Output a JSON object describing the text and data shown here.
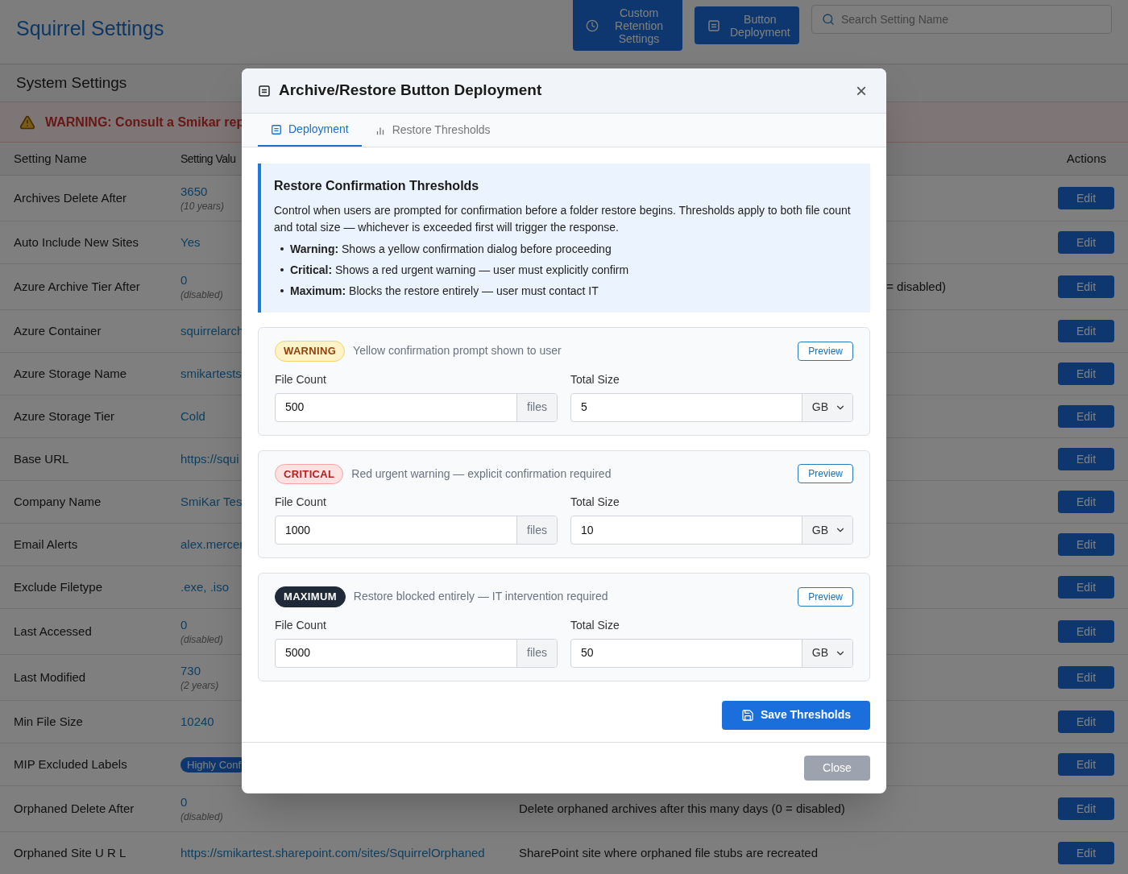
{
  "app_title": "Squirrel Settings",
  "header_buttons": [
    {
      "label": "Custom Retention Settings"
    },
    {
      "label": "Button Deployment"
    }
  ],
  "search": {
    "placeholder": "Search Setting Name"
  },
  "section_title": "System Settings",
  "warning": "WARNING: Consult a Smikar rep",
  "table": {
    "columns": [
      "Setting Name",
      "Setting Valu",
      "Actions"
    ],
    "rows": [
      {
        "name": "Archives Delete After",
        "value": "3650",
        "note": "(10 years)",
        "action": "Edit"
      },
      {
        "name": "Auto Include New Sites",
        "value": "Yes",
        "action": "Edit"
      },
      {
        "name": "Azure Archive Tier After",
        "value": "0",
        "note": "(disabled)",
        "description": "= disabled)",
        "description_cut": true,
        "action": "Edit"
      },
      {
        "name": "Azure Container",
        "value": "squirrelarch",
        "action": "Edit"
      },
      {
        "name": "Azure Storage Name",
        "value": "smikartests",
        "action": "Edit"
      },
      {
        "name": "Azure Storage Tier",
        "value": "Cold",
        "action": "Edit"
      },
      {
        "name": "Base URL",
        "value": "https://squi",
        "action": "Edit"
      },
      {
        "name": "Company Name",
        "value": "SmiKar Tes",
        "action": "Edit"
      },
      {
        "name": "Email Alerts",
        "value": "alex.mercer",
        "action": "Edit"
      },
      {
        "name": "Exclude Filetype",
        "value": ".exe, .iso",
        "action": "Edit"
      },
      {
        "name": "Last Accessed",
        "value": "0",
        "note": "(disabled)",
        "action": "Edit"
      },
      {
        "name": "Last Modified",
        "value": "730",
        "note": "(2 years)",
        "action": "Edit"
      },
      {
        "name": "Min File Size",
        "value": "10240",
        "action": "Edit"
      },
      {
        "name": "MIP Excluded Labels",
        "value": "Highly Conf",
        "kind": "badge",
        "action": "Edit"
      },
      {
        "name": "Orphaned Delete After",
        "value": "0",
        "note": "(disabled)",
        "description": "Delete orphaned archives after this many days (0 = disabled)",
        "description_cut": false,
        "action": "Edit"
      },
      {
        "name": "Orphaned Site U R L",
        "value": "https://smikartest.sharepoint.com/sites/SquirrelOrphaned",
        "description": "SharePoint site where orphaned file stubs are recreated",
        "description_cut": false,
        "action": "Edit"
      }
    ]
  },
  "dialog": {
    "title": "Archive/Restore Button Deployment",
    "close_symbol": "×",
    "tabs": [
      {
        "label": "Deployment",
        "selected": true
      },
      {
        "label": "Restore Thresholds",
        "selected": false
      }
    ],
    "info": {
      "title": "Restore Confirmation Thresholds",
      "text": "Control when users are prompted for confirmation before a folder restore begins. Thresholds apply to both file count and total size — whichever is exceeded first will trigger the response.",
      "bullets": [
        "**Warning:** Shows a yellow confirmation dialog before proceeding",
        "**Critical:** Shows a red urgent warning — user must explicitly confirm",
        "**Maximum:** Blocks the restore entirely — user must contact IT"
      ]
    },
    "thresholds": [
      {
        "kind": "warning",
        "badge": "WARNING",
        "description": "Yellow confirmation prompt shown to user",
        "preview": "Preview",
        "count_label": "File Count",
        "count": "500",
        "count_unit": "files",
        "size_label": "Total Size",
        "size": "5",
        "size_unit": "GB"
      },
      {
        "kind": "critical",
        "badge": "CRITICAL",
        "description": "Red urgent warning — explicit confirmation required",
        "preview": "Preview",
        "count_label": "File Count",
        "count": "1000",
        "count_unit": "files",
        "size_label": "Total Size",
        "size": "10",
        "size_unit": "GB"
      },
      {
        "kind": "maximum",
        "badge": "MAXIMUM",
        "description": "Restore blocked entirely — IT intervention required",
        "preview": "Preview",
        "count_label": "File Count",
        "count": "5000",
        "count_unit": "files",
        "size_label": "Total Size",
        "size": "50",
        "size_unit": "GB"
      }
    ],
    "save_button": "Save Thresholds",
    "close_button": "Close"
  }
}
